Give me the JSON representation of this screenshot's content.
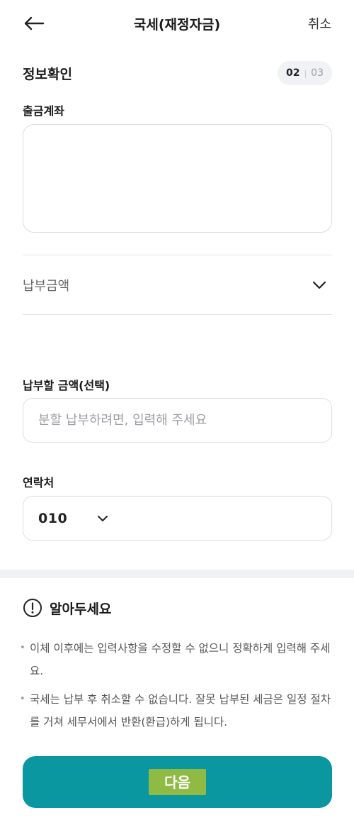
{
  "header": {
    "back_icon": "arrow-left-icon",
    "title": "국세(재정자금)",
    "cancel_label": "취소"
  },
  "section": {
    "title": "정보확인",
    "step_current": "02",
    "step_total": "03"
  },
  "account": {
    "label": "출금계좌",
    "value": ""
  },
  "amount": {
    "label": "납부금액",
    "expand_icon": "chevron-down-icon"
  },
  "partial_amount": {
    "label": "납부할 금액(선택)",
    "value": "",
    "placeholder": "분할 납부하려면, 입력해 주세요"
  },
  "contact": {
    "label": "연락처",
    "prefix": "010",
    "prefix_icon": "chevron-down-icon",
    "value": ""
  },
  "notice": {
    "icon": "info-circle-icon",
    "title": "알아두세요",
    "items": [
      "이체 이후에는 입력사항을 수정할 수 없으니 정확하게 입력해 주세요.",
      "국세는 납부 후 취소할 수 없습니다. 잘못 납부된 세금은 일정 절차를 거쳐 세무서에서 반환(환급)하게 됩니다."
    ]
  },
  "footer": {
    "next_label": "다음"
  },
  "colors": {
    "primary": "#0b97a0",
    "highlight": "#8fbb45",
    "border": "#dcdde0",
    "badge_bg": "#f1f2f5"
  }
}
